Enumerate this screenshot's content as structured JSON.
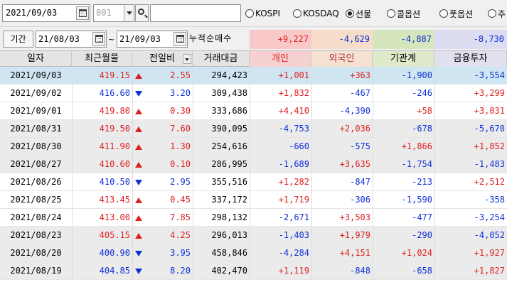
{
  "toolbar": {
    "date": "2021/09/03",
    "code_placeholder": "001",
    "name_value": "",
    "radios": [
      {
        "label": "KOSPI",
        "checked": false
      },
      {
        "label": "KOSDAQ",
        "checked": false
      },
      {
        "label": "선물",
        "checked": true
      },
      {
        "label": "콜옵션",
        "checked": false
      },
      {
        "label": "풋옵션",
        "checked": false
      },
      {
        "label": "주",
        "checked": false
      }
    ]
  },
  "period": {
    "label": "기간",
    "start": "21/08/03",
    "separator": "~",
    "end": "21/09/03",
    "cumulative_label": "누적순매수",
    "summary": [
      "+9,227",
      "-4,629",
      "-4,887",
      "-8,730"
    ]
  },
  "colors": {
    "up": "#e02020",
    "down": "#1030d8",
    "selected_row": "#cfe5f1",
    "summary_individual_bg": "#f9c9c9",
    "summary_foreign_bg": "#f5ddc9",
    "summary_institution_bg": "#d6e6bc",
    "summary_finance_bg": "#dcdcf0",
    "header_individual_bg": "#f7d1d1",
    "header_foreign_bg": "#f5e1d1",
    "header_institution_bg": "#dde9c8",
    "header_finance_bg": "#e0e0ef"
  },
  "table": {
    "headers": [
      "일자",
      "최근월물",
      "전일비",
      "거래대금",
      "개인",
      "외국인",
      "기관계",
      "금융투자"
    ],
    "rows": [
      {
        "date": "2021/09/03",
        "price": "419.15",
        "dir": "up",
        "change": "2.55",
        "amount": "294,423",
        "individual": "+1,001",
        "foreign": "+363",
        "institution": "-1,900",
        "finance": "-3,554"
      },
      {
        "date": "2021/09/02",
        "price": "416.60",
        "dir": "down",
        "change": "3.20",
        "amount": "309,438",
        "individual": "+1,832",
        "foreign": "-467",
        "institution": "-246",
        "finance": "+3,299"
      },
      {
        "date": "2021/09/01",
        "price": "419.80",
        "dir": "up",
        "change": "0.30",
        "amount": "333,686",
        "individual": "+4,410",
        "foreign": "-4,390",
        "institution": "+58",
        "finance": "+3,031"
      },
      {
        "date": "2021/08/31",
        "price": "419.50",
        "dir": "up",
        "change": "7.60",
        "amount": "390,095",
        "individual": "-4,753",
        "foreign": "+2,036",
        "institution": "-678",
        "finance": "-5,670"
      },
      {
        "date": "2021/08/30",
        "price": "411.90",
        "dir": "up",
        "change": "1.30",
        "amount": "254,616",
        "individual": "-660",
        "foreign": "-575",
        "institution": "+1,866",
        "finance": "+1,852"
      },
      {
        "date": "2021/08/27",
        "price": "410.60",
        "dir": "up",
        "change": "0.10",
        "amount": "286,995",
        "individual": "-1,689",
        "foreign": "+3,635",
        "institution": "-1,754",
        "finance": "-1,483"
      },
      {
        "date": "2021/08/26",
        "price": "410.50",
        "dir": "down",
        "change": "2.95",
        "amount": "355,516",
        "individual": "+1,282",
        "foreign": "-847",
        "institution": "-213",
        "finance": "+2,512"
      },
      {
        "date": "2021/08/25",
        "price": "413.45",
        "dir": "up",
        "change": "0.45",
        "amount": "337,172",
        "individual": "+1,719",
        "foreign": "-306",
        "institution": "-1,590",
        "finance": "-358"
      },
      {
        "date": "2021/08/24",
        "price": "413.00",
        "dir": "up",
        "change": "7.85",
        "amount": "298,132",
        "individual": "-2,671",
        "foreign": "+3,503",
        "institution": "-477",
        "finance": "-3,254"
      },
      {
        "date": "2021/08/23",
        "price": "405.15",
        "dir": "up",
        "change": "4.25",
        "amount": "296,013",
        "individual": "-1,403",
        "foreign": "+1,979",
        "institution": "-290",
        "finance": "-4,052"
      },
      {
        "date": "2021/08/20",
        "price": "400.90",
        "dir": "down",
        "change": "3.95",
        "amount": "458,846",
        "individual": "-4,284",
        "foreign": "+4,151",
        "institution": "+1,024",
        "finance": "+1,927"
      },
      {
        "date": "2021/08/19",
        "price": "404.85",
        "dir": "down",
        "change": "8.20",
        "amount": "402,470",
        "individual": "+1,119",
        "foreign": "-848",
        "institution": "-658",
        "finance": "+1,827"
      }
    ]
  }
}
